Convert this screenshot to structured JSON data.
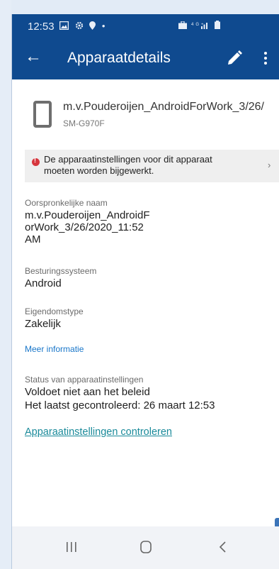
{
  "status_bar": {
    "time": "12:53"
  },
  "toolbar": {
    "title": "Apparaatdetails"
  },
  "device": {
    "name": "m.v.Pouderoijen_AndroidForWork_3/26/",
    "model": "SM-G970F"
  },
  "alert": {
    "line1": "De apparaatinstellingen voor dit apparaat",
    "line2": "moeten worden bijgewerkt."
  },
  "details": {
    "original_name_label": "Oorspronkelijke naam",
    "original_name_line1": "m.v.Pouderoijen_AndroidF",
    "original_name_line2": "orWork_3/26/2020_11:52",
    "original_name_line3": "AM",
    "os_label": "Besturingssysteem",
    "os_value": "Android",
    "ownership_label": "Eigendomstype",
    "ownership_value": "Zakelijk",
    "more_info": "Meer informatie",
    "compliance_label": "Status van apparaatinstellingen",
    "compliance_value": "Voldoet niet aan het beleid",
    "last_checked": "Het laatst gecontroleerd: 26 maart 12:53",
    "check_link": "Apparaatinstellingen controleren"
  },
  "colors": {
    "appbar": "#0f4a8f",
    "alert_icon": "#d6363e",
    "link": "#1976c9"
  },
  "icons": [
    "back-arrow-icon",
    "edit-pencil-icon",
    "more-vert-icon",
    "phone-device-icon",
    "error-icon",
    "chevron-right-icon",
    "nav-recents-icon",
    "nav-home-icon",
    "nav-back-icon"
  ]
}
